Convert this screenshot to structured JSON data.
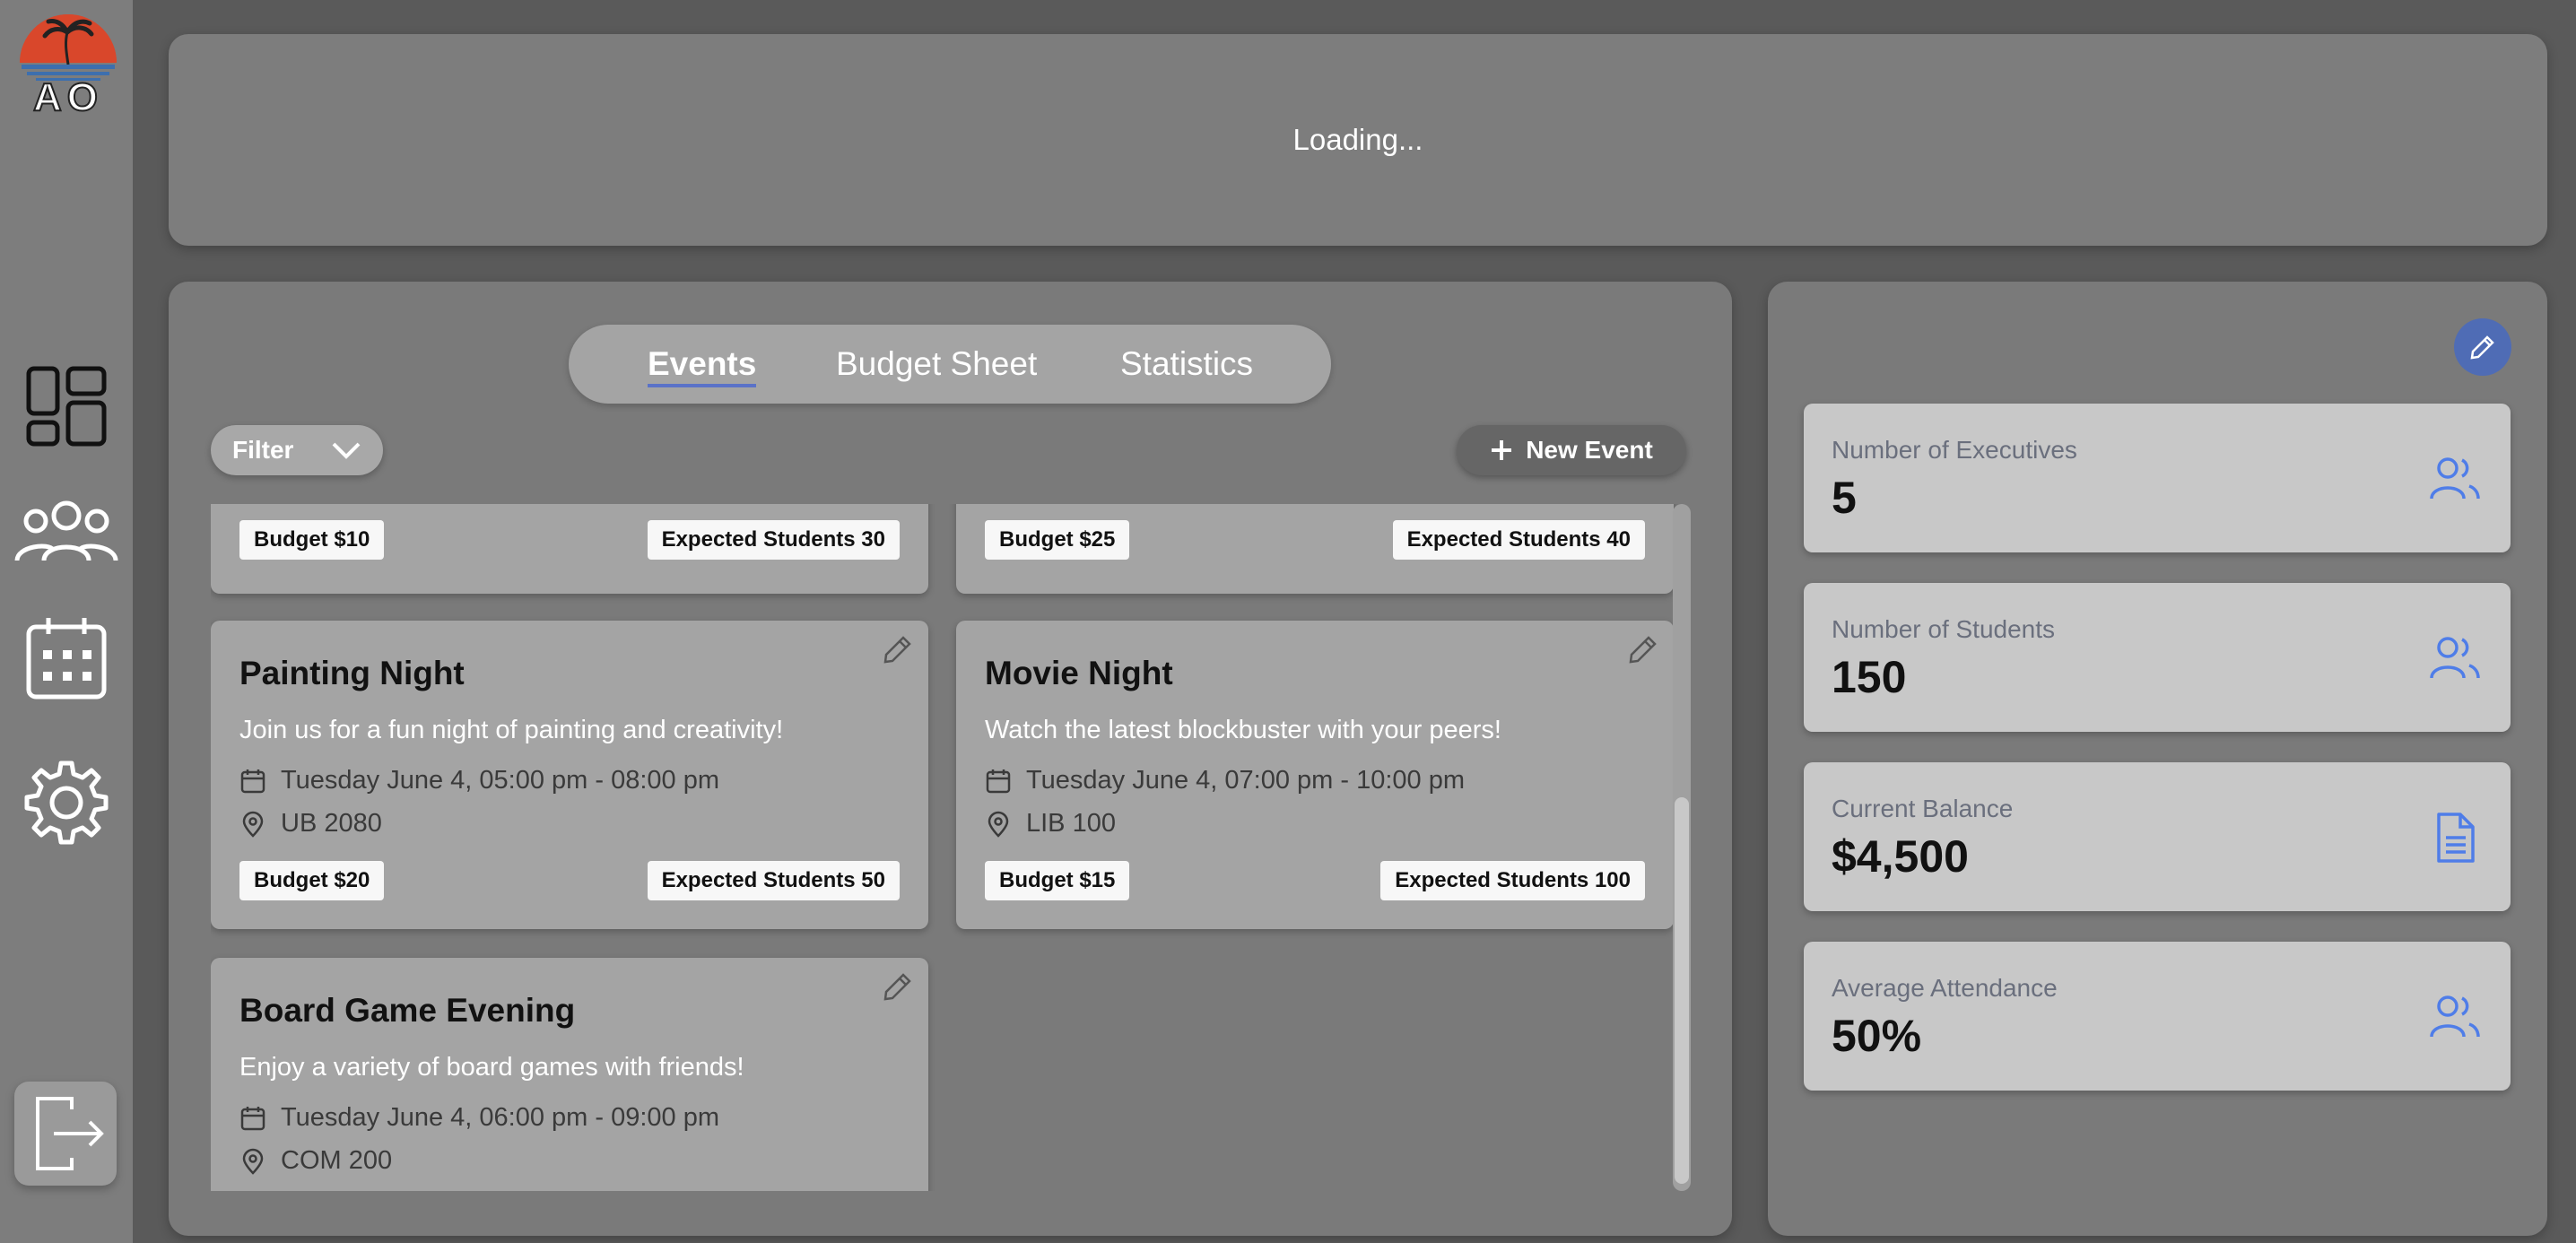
{
  "sidebar": {
    "logo_text": "AO",
    "nav": [
      {
        "icon": "dashboard-icon"
      },
      {
        "icon": "users-group-icon"
      },
      {
        "icon": "calendar-icon"
      },
      {
        "icon": "gear-icon"
      }
    ],
    "logout_icon": "logout-icon"
  },
  "banner": {
    "text": "Loading..."
  },
  "tabs": [
    {
      "label": "Events",
      "active": true
    },
    {
      "label": "Budget Sheet",
      "active": false
    },
    {
      "label": "Statistics",
      "active": false
    }
  ],
  "toolbar": {
    "filter_label": "Filter",
    "new_event_label": "New Event"
  },
  "events": [
    {
      "title": "",
      "budget": "Budget $10",
      "expected": "Expected Students 30"
    },
    {
      "title": "",
      "budget": "Budget $25",
      "expected": "Expected Students 40"
    },
    {
      "title": "Painting Night",
      "description": "Join us for a fun night of painting and creativity!",
      "datetime": "Tuesday June 4, 05:00 pm - 08:00 pm",
      "location": "UB 2080",
      "budget": "Budget $20",
      "expected": "Expected Students 50"
    },
    {
      "title": "Movie Night",
      "description": "Watch the latest blockbuster with your peers!",
      "datetime": "Tuesday June 4, 07:00 pm - 10:00 pm",
      "location": "LIB 100",
      "budget": "Budget $15",
      "expected": "Expected Students 100"
    },
    {
      "title": "Board Game Evening",
      "description": "Enjoy a variety of board games with friends!",
      "datetime": "Tuesday June 4, 06:00 pm - 09:00 pm",
      "location": "COM 200"
    }
  ],
  "stats": [
    {
      "label": "Number of Executives",
      "value": "5",
      "icon": "users-icon"
    },
    {
      "label": "Number of Students",
      "value": "150",
      "icon": "users-icon"
    },
    {
      "label": "Current Balance",
      "value": "$4,500",
      "icon": "document-icon"
    },
    {
      "label": "Average Attendance",
      "value": "50%",
      "icon": "users-icon"
    }
  ],
  "colors": {
    "accent": "#5a72c8",
    "icon_blue": "#4f7de8",
    "edit_circle": "#4f6cb5"
  }
}
